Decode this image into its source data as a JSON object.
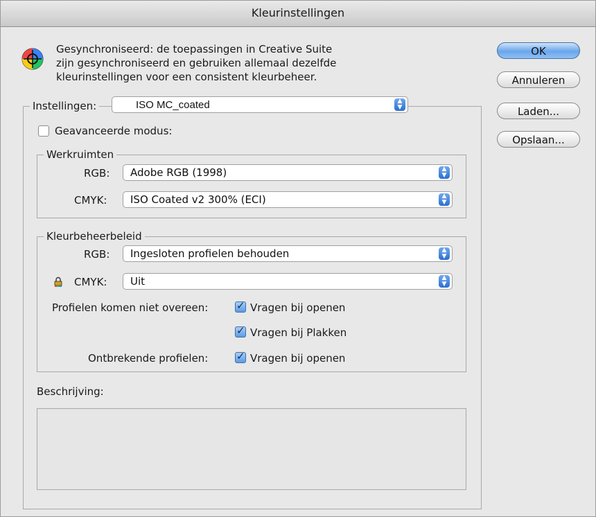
{
  "window": {
    "title": "Kleurinstellingen"
  },
  "sync_text": "Gesynchroniseerd: de toepassingen in Creative Suite\nzijn gesynchroniseerd en gebruiken allemaal dezelfde\nkleurinstellingen voor een consistent kleurbeheer.",
  "buttons": {
    "ok": "OK",
    "cancel": "Annuleren",
    "load": "Laden...",
    "save": "Opslaan..."
  },
  "settings": {
    "label": "Instellingen:",
    "value": "ISO MC_coated"
  },
  "advanced_mode": {
    "label": "Geavanceerde modus:",
    "checked": false
  },
  "working_spaces": {
    "legend": "Werkruimten",
    "rgb_label": "RGB:",
    "rgb_value": "Adobe RGB (1998)",
    "cmyk_label": "CMYK:",
    "cmyk_value": "ISO Coated v2 300% (ECI)"
  },
  "color_policy": {
    "legend": "Kleurbeheerbeleid",
    "rgb_label": "RGB:",
    "rgb_value": "Ingesloten profielen behouden",
    "cmyk_label": "CMYK:",
    "cmyk_value": "Uit",
    "mismatch_label": "Profielen komen niet overeen:",
    "mismatch_open": "Vragen bij openen",
    "mismatch_paste": "Vragen bij Plakken",
    "missing_label": "Ontbrekende profielen:",
    "missing_open": "Vragen bij openen"
  },
  "description": {
    "label": "Beschrijving:"
  },
  "icons": {
    "color_wheel": "color-wheel-icon",
    "lock": "lock-icon"
  }
}
